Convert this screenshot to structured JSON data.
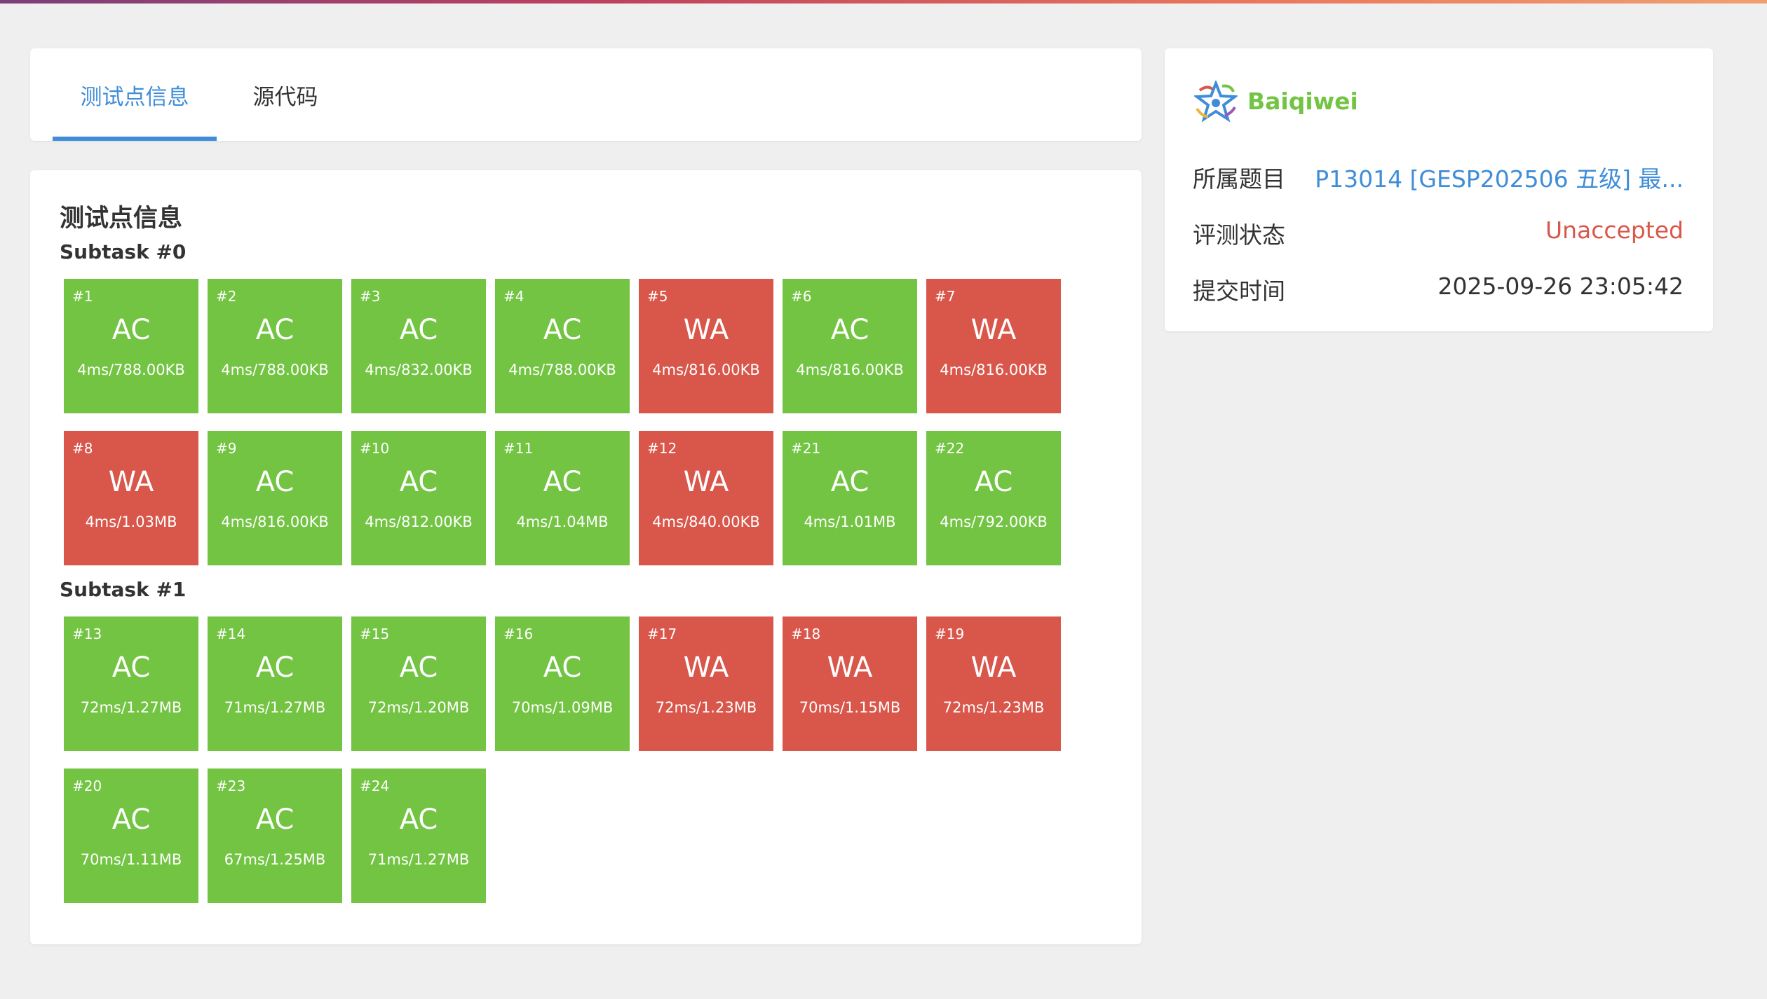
{
  "tabs": [
    {
      "label": "测试点信息",
      "active": true
    },
    {
      "label": "源代码",
      "active": false
    }
  ],
  "main": {
    "title": "测试点信息",
    "subtasks": [
      {
        "title": "Subtask #0",
        "cases": [
          {
            "id": "#1",
            "verdict": "AC",
            "stat": "4ms/788.00KB"
          },
          {
            "id": "#2",
            "verdict": "AC",
            "stat": "4ms/788.00KB"
          },
          {
            "id": "#3",
            "verdict": "AC",
            "stat": "4ms/832.00KB"
          },
          {
            "id": "#4",
            "verdict": "AC",
            "stat": "4ms/788.00KB"
          },
          {
            "id": "#5",
            "verdict": "WA",
            "stat": "4ms/816.00KB"
          },
          {
            "id": "#6",
            "verdict": "AC",
            "stat": "4ms/816.00KB"
          },
          {
            "id": "#7",
            "verdict": "WA",
            "stat": "4ms/816.00KB"
          },
          {
            "id": "#8",
            "verdict": "WA",
            "stat": "4ms/1.03MB"
          },
          {
            "id": "#9",
            "verdict": "AC",
            "stat": "4ms/816.00KB"
          },
          {
            "id": "#10",
            "verdict": "AC",
            "stat": "4ms/812.00KB"
          },
          {
            "id": "#11",
            "verdict": "AC",
            "stat": "4ms/1.04MB"
          },
          {
            "id": "#12",
            "verdict": "WA",
            "stat": "4ms/840.00KB"
          },
          {
            "id": "#21",
            "verdict": "AC",
            "stat": "4ms/1.01MB"
          },
          {
            "id": "#22",
            "verdict": "AC",
            "stat": "4ms/792.00KB"
          }
        ]
      },
      {
        "title": "Subtask #1",
        "cases": [
          {
            "id": "#13",
            "verdict": "AC",
            "stat": "72ms/1.27MB"
          },
          {
            "id": "#14",
            "verdict": "AC",
            "stat": "71ms/1.27MB"
          },
          {
            "id": "#15",
            "verdict": "AC",
            "stat": "72ms/1.20MB"
          },
          {
            "id": "#16",
            "verdict": "AC",
            "stat": "70ms/1.09MB"
          },
          {
            "id": "#17",
            "verdict": "WA",
            "stat": "72ms/1.23MB"
          },
          {
            "id": "#18",
            "verdict": "WA",
            "stat": "70ms/1.15MB"
          },
          {
            "id": "#19",
            "verdict": "WA",
            "stat": "72ms/1.23MB"
          },
          {
            "id": "#20",
            "verdict": "AC",
            "stat": "70ms/1.11MB"
          },
          {
            "id": "#23",
            "verdict": "AC",
            "stat": "67ms/1.25MB"
          },
          {
            "id": "#24",
            "verdict": "AC",
            "stat": "71ms/1.27MB"
          }
        ]
      }
    ]
  },
  "sidebar": {
    "user_name": "Baiqiwei",
    "logo_icon": "star-logo-icon",
    "rows": [
      {
        "label": "所属题目",
        "value": "P13014 [GESP202506 五级] 最..."
      },
      {
        "label": "评测状态",
        "value": "Unaccepted"
      },
      {
        "label": "提交时间",
        "value": "2025-09-26 23:05:42"
      }
    ]
  },
  "colors": {
    "accent": "#3f8dd8",
    "ac": "#72c442",
    "wa": "#d9564a",
    "background": "#efefef"
  }
}
